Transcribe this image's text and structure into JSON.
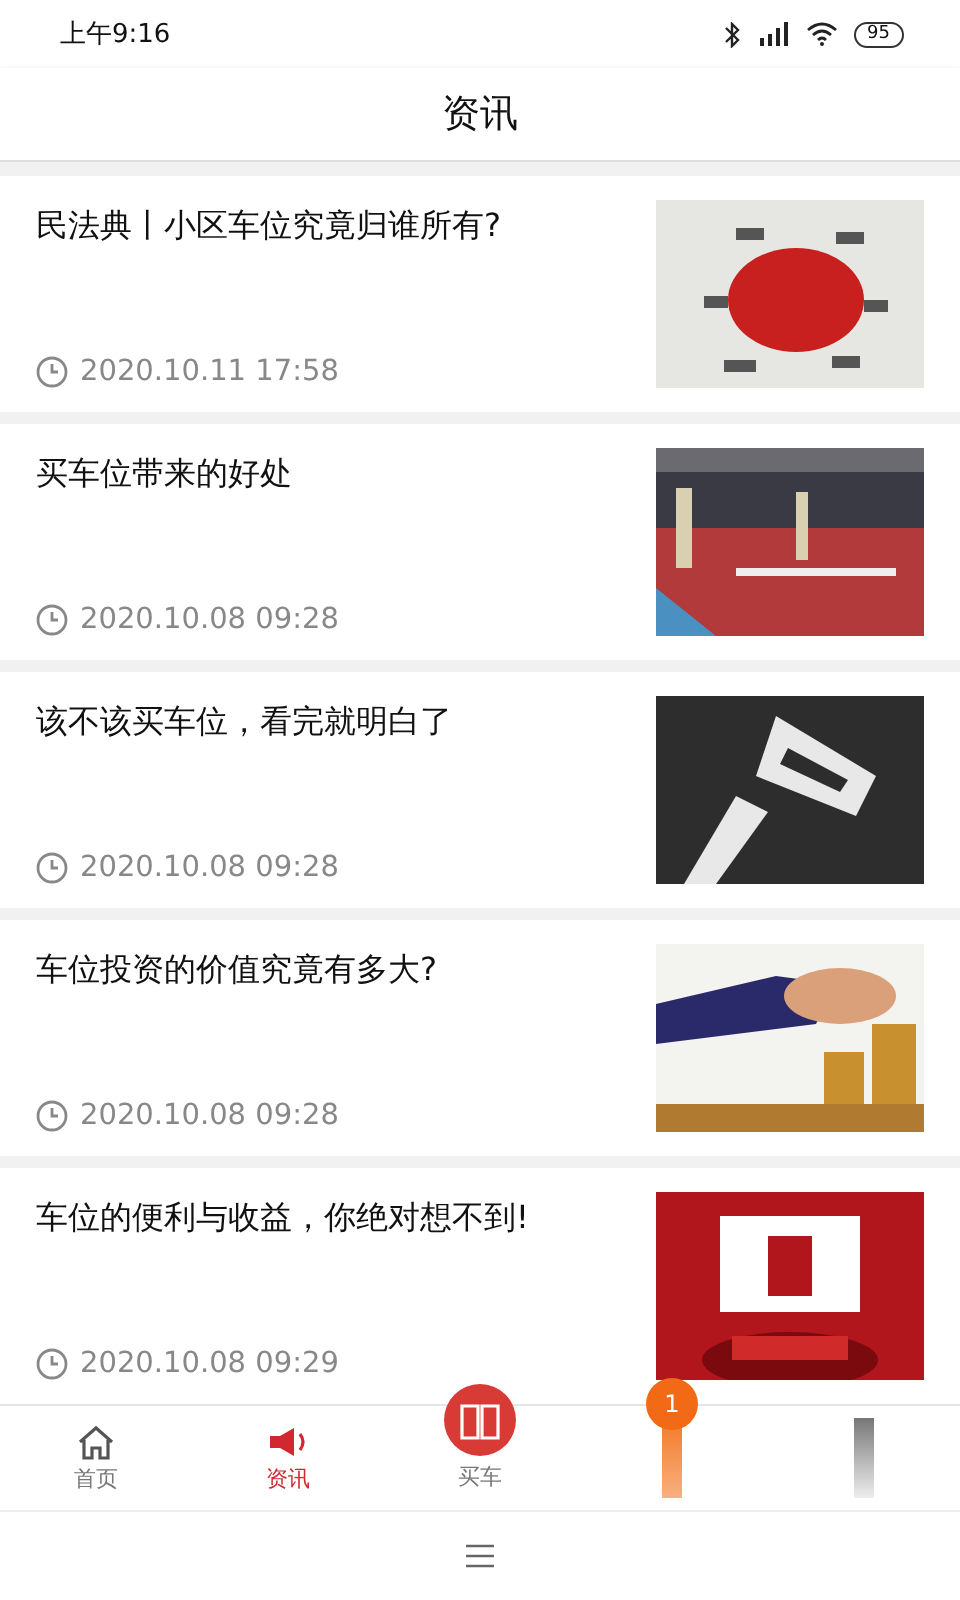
{
  "status_bar": {
    "time": "上午9:16",
    "battery": "95"
  },
  "header": {
    "title": "资讯"
  },
  "articles": [
    {
      "title": "民法典丨小区车位究竟归谁所有?",
      "date": "2020.10.11 17:58"
    },
    {
      "title": "买车位带来的好处",
      "date": "2020.10.08 09:28"
    },
    {
      "title": "该不该买车位，看完就明白了",
      "date": "2020.10.08 09:28"
    },
    {
      "title": "车位投资的价值究竟有多大?",
      "date": "2020.10.08 09:28"
    },
    {
      "title": "车位的便利与收益，你绝对想不到!",
      "date": "2020.10.08 09:29"
    }
  ],
  "tab_bar": [
    {
      "kind": "home",
      "label": "首页",
      "selected": false
    },
    {
      "kind": "news",
      "label": "资讯",
      "selected": true
    },
    {
      "kind": "buy",
      "label": "买车",
      "selected": false
    },
    {
      "kind": "badge",
      "badge": "1"
    },
    {
      "kind": "blank"
    }
  ]
}
